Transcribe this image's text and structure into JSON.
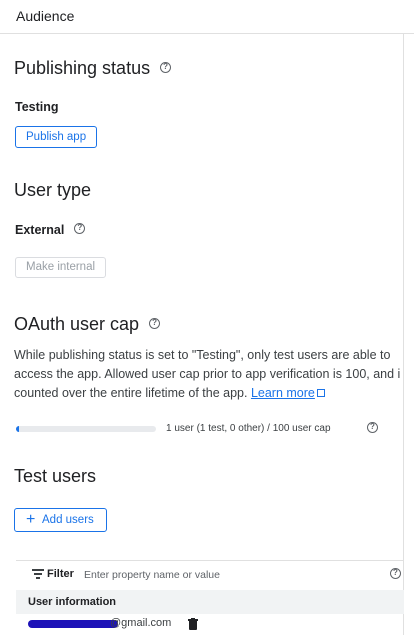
{
  "header": {
    "title": "Audience"
  },
  "publishing": {
    "heading": "Publishing status",
    "status": "Testing",
    "publish_label": "Publish app"
  },
  "user_type": {
    "heading": "User type",
    "value": "External",
    "make_internal_label": "Make internal"
  },
  "oauth_cap": {
    "heading": "OAuth user cap",
    "line1": "While publishing status is set to \"Testing\", only test users are able to",
    "line2": "access the app. Allowed user cap prior to app verification is 100, and i",
    "line3_prefix": "counted over the entire lifetime of the app. ",
    "learn_more": "Learn more",
    "usage_text": "1 user (1 test, 0 other) / 100 user cap",
    "usage_fraction": 0.01
  },
  "test_users": {
    "heading": "Test users",
    "add_label": "Add users",
    "filter_label": "Filter",
    "filter_placeholder": "Enter property name or value",
    "column_header": "User information",
    "rows": [
      {
        "email": "@gmail.com"
      }
    ]
  },
  "icons": {
    "help": "help-circle-icon",
    "external": "external-link-icon",
    "filter": "filter-list-icon",
    "delete": "trash-icon",
    "add": "plus-icon"
  },
  "colors": {
    "accent": "#1a73e8",
    "redaction": "#1d12b8"
  }
}
